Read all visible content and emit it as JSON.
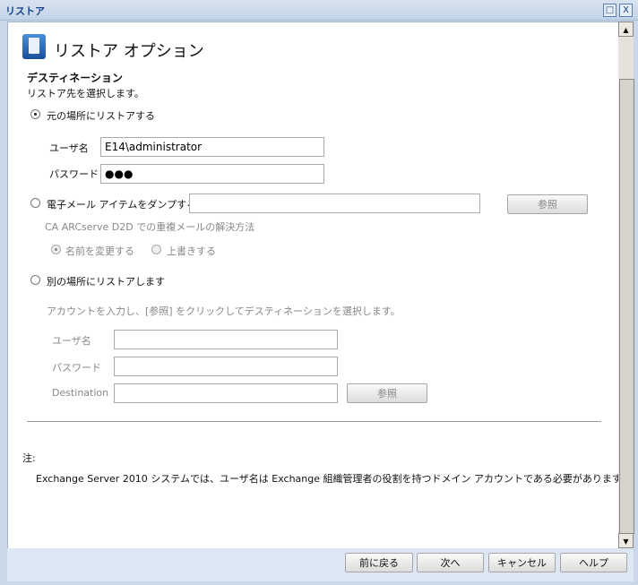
{
  "window": {
    "title": "リストア",
    "maximize_icon": "□",
    "close_icon": "X"
  },
  "header": {
    "title": "リストア オプション"
  },
  "section": {
    "title": "デスティネーション",
    "description": "リストア先を選択します。"
  },
  "option1": {
    "label": "元の場所にリストアする",
    "selected": true,
    "username_label": "ユーザ名",
    "username_value": "E14\\administrator",
    "password_label": "パスワード",
    "password_value": "●●●"
  },
  "option2": {
    "label": "電子メール アイテムをダンプする",
    "selected": false,
    "path_value": "",
    "browse_label": "参照",
    "conflict_label": "CA ARCserve D2D での重複メールの解決方法",
    "rename_label": "名前を変更する",
    "rename_selected": true,
    "overwrite_label": "上書きする"
  },
  "option3": {
    "label": "別の場所にリストアします",
    "selected": false,
    "instruction": "アカウントを入力し、[参照] をクリックしてデスティネーションを選択します。",
    "username_label": "ユーザ名",
    "password_label": "パスワード",
    "destination_label": "Destination",
    "browse_label": "参照"
  },
  "note": {
    "label": "注:",
    "text": "Exchange Server 2010 システムでは、ユーザ名は Exchange 組織管理者の役割を持つドメイン アカウントである必要があります。"
  },
  "footer": {
    "back": "前に戻る",
    "next": "次へ",
    "cancel": "キャンセル",
    "help": "ヘルプ"
  }
}
